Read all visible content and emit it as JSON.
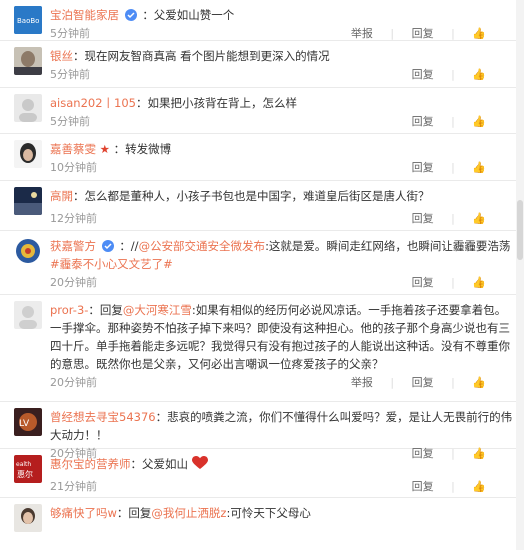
{
  "comments": [
    {
      "user": "宝泊智能家居",
      "verified": true,
      "text_parts": [
        "：父爱如山赞一个"
      ],
      "time": "5分钟前",
      "report": "举报",
      "reply": "回复",
      "like": ""
    },
    {
      "user": "银丝",
      "text_parts": [
        "：现在网友智商真高 看个图片能想到更深入的情况"
      ],
      "time": "5分钟前",
      "reply": "回复",
      "like": ""
    },
    {
      "user": "aisan202丨105",
      "text_parts": [
        "：如果把小孩背在背上，怎么样"
      ],
      "time": "5分钟前",
      "reply": "回复",
      "like": ""
    },
    {
      "user": "嘉善蔡雯",
      "text_parts": [
        "：转发微博"
      ],
      "time": "10分钟前",
      "reply": "回复",
      "like": ""
    },
    {
      "user": "高開",
      "text_parts": [
        "：怎么都是董种人，小孩子书包也是中国字，难道皇后街区是唐人街？"
      ],
      "time": "12分钟前",
      "reply": "回复",
      "like": ""
    },
    {
      "user": "获嘉警方",
      "verified": true,
      "text_before": "：//",
      "mention": "@公安部交通安全微发布",
      "text_after": ":这就是爱。瞬间走红网络，也瞬间让霾霾要浩荡",
      "hashtag": "#霾泰不小心又文艺了#",
      "time": "20分钟前",
      "reply": "回复",
      "like": ""
    },
    {
      "user": "pror-3-",
      "text_before": "：回复",
      "mention": "@大河寒江雪",
      "text_after": ":如果有相似的经历何必说风凉话。一手拖着孩子还要拿着包。一手撑伞。那种姿势不怕孩子掉下来吗？即使没有这种担心。他的孩子那个身高少说也有三四十斤。单手拖着能走多远呢？我觉得只有没有抱过孩子的人能说出这种话。没有不尊重你的意思。既然你也是父亲，又何必出言嘲讽一位疼爱孩子的父亲？",
      "time": "20分钟前",
      "report": "举报",
      "reply": "回复",
      "like": ""
    },
    {
      "user": "曾经想去寻宝54376",
      "text_parts": [
        "：悲哀的喷粪之流，你们不懂得什么叫爱吗？爱，是让人无畏前行的伟大动力！！"
      ],
      "time": "20分钟前",
      "reply": "回复",
      "like": ""
    },
    {
      "user": "惠尔宝的营养师",
      "text_parts": [
        "：父爱如山"
      ],
      "emoji": "heart",
      "time": "21分钟前",
      "reply": "回复",
      "like": ""
    },
    {
      "user": "够痛快了吗w",
      "text_before": "：回复",
      "mention": "@我何止洒脱z",
      "text_after": ":可怜天下父母心",
      "time": "",
      "reply": "",
      "like": ""
    }
  ],
  "colors": {
    "accent": "#eb7350",
    "verified": "#4d8cf5"
  }
}
